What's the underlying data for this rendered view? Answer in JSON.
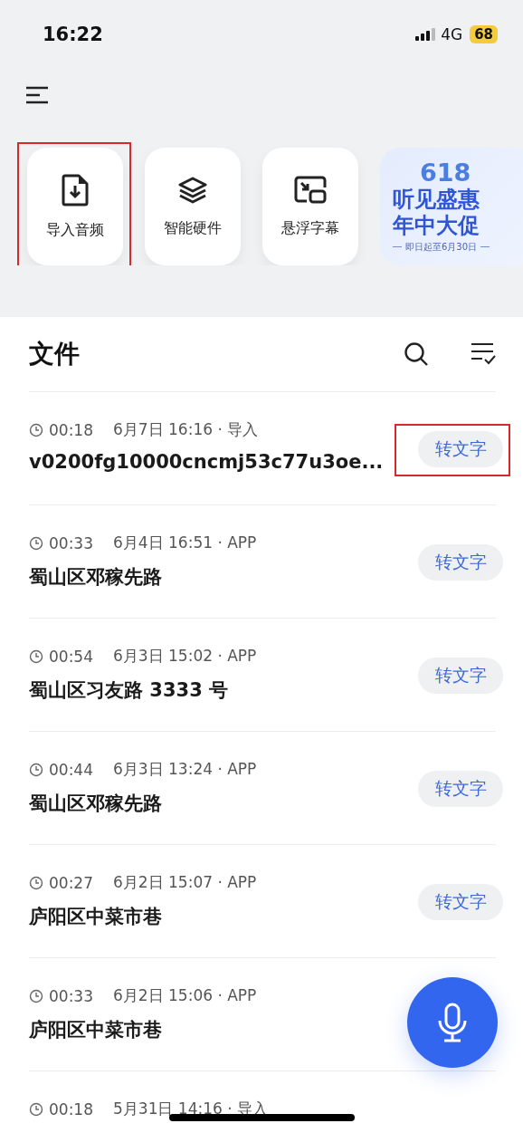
{
  "status_bar": {
    "time": "16:22",
    "network": "4G",
    "battery": "68"
  },
  "shortcuts": [
    {
      "kind": "import",
      "label": "导入音频",
      "highlighted": true
    },
    {
      "kind": "hardware",
      "label": "智能硬件",
      "highlighted": false
    },
    {
      "kind": "float",
      "label": "悬浮字幕",
      "highlighted": false
    }
  ],
  "banner": {
    "number": "618",
    "line_1": "听见盛惠",
    "line_2": "年中大促",
    "note": "即日起至6月30日"
  },
  "files_header": {
    "title": "文件"
  },
  "files": [
    {
      "duration": "00:18",
      "meta": "6月7日 16:16 · 导入",
      "title": "v0200fg10000cncmj53c77u3oe...",
      "action": "转文字",
      "highlighted": true
    },
    {
      "duration": "00:33",
      "meta": "6月4日 16:51 · APP",
      "title": "蜀山区邓稼先路",
      "action": "转文字",
      "highlighted": false
    },
    {
      "duration": "00:54",
      "meta": "6月3日 15:02 · APP",
      "title": "蜀山区习友路 3333 号",
      "action": "转文字",
      "highlighted": false
    },
    {
      "duration": "00:44",
      "meta": "6月3日 13:24 · APP",
      "title": "蜀山区邓稼先路",
      "action": "转文字",
      "highlighted": false
    },
    {
      "duration": "00:27",
      "meta": "6月2日 15:07 · APP",
      "title": "庐阳区中菜市巷",
      "action": "转文字",
      "highlighted": false
    },
    {
      "duration": "00:33",
      "meta": "6月2日 15:06 · APP",
      "title": "庐阳区中菜市巷",
      "highlighted": false
    },
    {
      "duration": "00:18",
      "meta": "5月31日 14:16 · 导入",
      "highlighted": false
    }
  ]
}
